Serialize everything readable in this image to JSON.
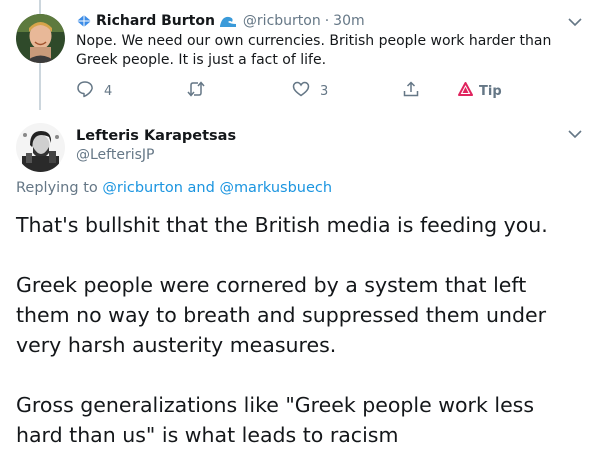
{
  "reply_tweet": {
    "author_name": "Richard Burton",
    "handle": "@ricburton",
    "separator": "·",
    "time": "30m",
    "text": "Nope. We need our own currencies. British people work harder than Greek people. It is just a fact of life.",
    "actions": {
      "reply_count": "4",
      "retweet_count": "",
      "like_count": "3",
      "tip_label": "Tip"
    }
  },
  "main_tweet": {
    "author_name": "Lefteris Karapetsas",
    "handle": "@LefterisJP",
    "replying_prefix": "Replying to",
    "replying_user_1": "@ricburton",
    "replying_and": "and",
    "replying_user_2": "@markusbuech",
    "paragraphs": [
      "That's bullshit that the British media is feeding you.",
      "Greek people were cornered by a system that left them no way to breath and suppressed them under very harsh austerity measures.",
      "Gross generalizations like \"Greek people work less hard than us\" is what leads to racism"
    ]
  },
  "colors": {
    "link": "#1b95e0",
    "muted": "#657786",
    "text": "#14171a",
    "thread_line": "#ccd6dd",
    "tip_icon": "#e0245e"
  },
  "icons": {
    "name_prefix": "kite-icon",
    "name_suffix": "wave-icon",
    "reply": "comment-icon",
    "retweet": "retweet-icon",
    "like": "heart-icon",
    "share": "share-icon",
    "tip": "tip-triangle-icon",
    "menu": "chevron-down-icon"
  }
}
